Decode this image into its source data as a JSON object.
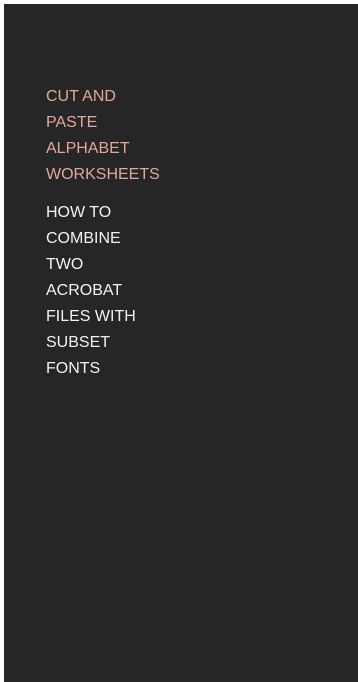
{
  "colors": {
    "background": "#262626",
    "frame": "#ffffff",
    "active_link": "#e3a79c",
    "link": "#f2f2f2"
  },
  "links": [
    {
      "lines": [
        "CUT AND",
        "PASTE",
        "ALPHABET",
        "WORKSHEETS"
      ],
      "state": "active"
    },
    {
      "lines": [
        "HOW TO",
        "COMBINE",
        "TWO",
        "ACROBAT",
        "FILES WITH",
        "SUBSET",
        "FONTS"
      ],
      "state": "normal"
    }
  ]
}
